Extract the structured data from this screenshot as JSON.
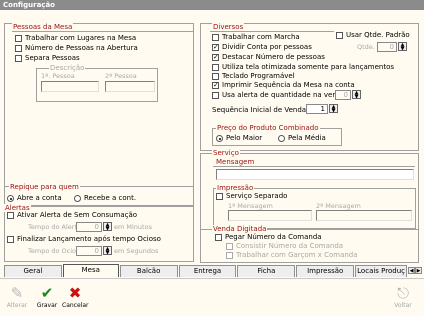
{
  "window": {
    "title": "Configuração"
  },
  "pessoas": {
    "title": "Pessoas da Mesa",
    "trabalhar_lugares": "Trabalhar com Lugares na Mesa",
    "numero_pessoas": "Número de Pessoas na Abertura",
    "separa_pessoas": "Separa Pessoas",
    "descricao_title": "Descrição",
    "primeira_pessoa": "1ª. Pessoa",
    "segunda_pessoa": "2ª Pessoa"
  },
  "repique": {
    "title": "Repique para quem",
    "abre_conta": "Abre a conta",
    "recebe_conta": "Recebe a cont."
  },
  "alertas": {
    "title": "Alertas",
    "ativar_alerta": "Ativar Alerta de Sem Consumação",
    "tempo_alerta_label": "Tempo do Alerta",
    "tempo_alerta_value": "0",
    "em_minutos": "em Minutos",
    "finalizar": "Finalizar Lançamento após tempo Ocioso",
    "tempo_ocioso_label": "Tempo do Ocioso",
    "tempo_ocioso_value": "0",
    "em_segundos": "em Segundos"
  },
  "diversos": {
    "title": "Diversos",
    "trabalhar_marcha": "Trabalhar com Marcha",
    "usar_qtde_padrao": "Usar Qtde. Padrão",
    "qtde_label": "Qtde.",
    "qtde_value": "0",
    "dividir_conta": "Dividir Conta por pessoas",
    "destacar_numero": "Destacar Número de pessoas",
    "utiliza_tela": "Utiliza tela otimizada somente para lançamentos",
    "teclado_programavel": "Teclado Programável",
    "imprimir_sequencia": "Imprimir Sequência da Mesa na conta",
    "usa_alerta_qtd": "Usa alerta de quantidade na venda",
    "alerta_qtd_value": "0",
    "sequencia_label": "Sequência Inicial de Venda:",
    "sequencia_value": "1"
  },
  "preco": {
    "title": "Preço do Produto Combinado",
    "pelo_maior": "Pelo Maior",
    "pela_media": "Pela Média"
  },
  "servico": {
    "title": "Serviço",
    "mensagem": "Mensagem"
  },
  "impressao": {
    "title": "Impressão",
    "servico_separado": "Serviço Separado",
    "primeira_mensagem": "1ª Mensagem",
    "segunda_mensagem": "2ª Mensagem"
  },
  "venda": {
    "title": "Venda Digitada",
    "pegar_numero": "Pegar Número da Comanda",
    "consistir": "Consistir Número da Comanda",
    "trabalhar_garcom": "Trabalhar com Garçom x Comanda"
  },
  "tabs": [
    "Geral",
    "Mesa",
    "Balcão",
    "Entrega",
    "Ficha",
    "Impressão",
    "Locais Produç"
  ],
  "toolbar": {
    "alterar": "Alterar",
    "gravar": "Gravar",
    "cancelar": "Cancelar",
    "voltar": "Voltar"
  },
  "colors": {
    "group_title": "#9a1010",
    "background": "#fffbf0",
    "titlebar": "#8b8b8b",
    "gravar_icon": "#1a8a1a",
    "cancelar_icon": "#cc1010"
  }
}
